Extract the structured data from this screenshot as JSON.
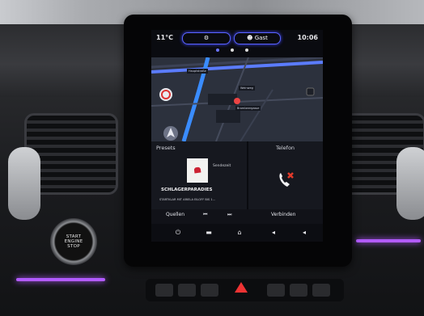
{
  "status_bar": {
    "temperature": "11°C",
    "profile_label": "Gast",
    "time": "10:06"
  },
  "map": {
    "street_labels": [
      "Hauptstraße",
      "Weinweg",
      "Brombeergasse"
    ]
  },
  "presets": {
    "title": "Presets",
    "sender_tag": "Sendezeit",
    "station": "SCHLAGERPARADIES",
    "track": "STARTKLAR MIT ARIELA EILOFF BIS 1..."
  },
  "phone": {
    "title": "Telefon"
  },
  "controls": {
    "source_label": "Quellen",
    "connect_label": "Verbinden"
  },
  "start_button": {
    "line1": "START",
    "line2": "ENGINE",
    "line3": "STOP"
  },
  "colors": {
    "accent": "#5a63ff",
    "ambient": "#b25bff",
    "phone_red": "#e23a2a"
  },
  "icons": [
    "gear-icon",
    "user-icon",
    "location-arrow-icon",
    "phone-missed-icon",
    "power-icon",
    "home-icon",
    "volume-icon",
    "skip-back-icon",
    "skip-forward-icon",
    "equalizer-icon"
  ]
}
